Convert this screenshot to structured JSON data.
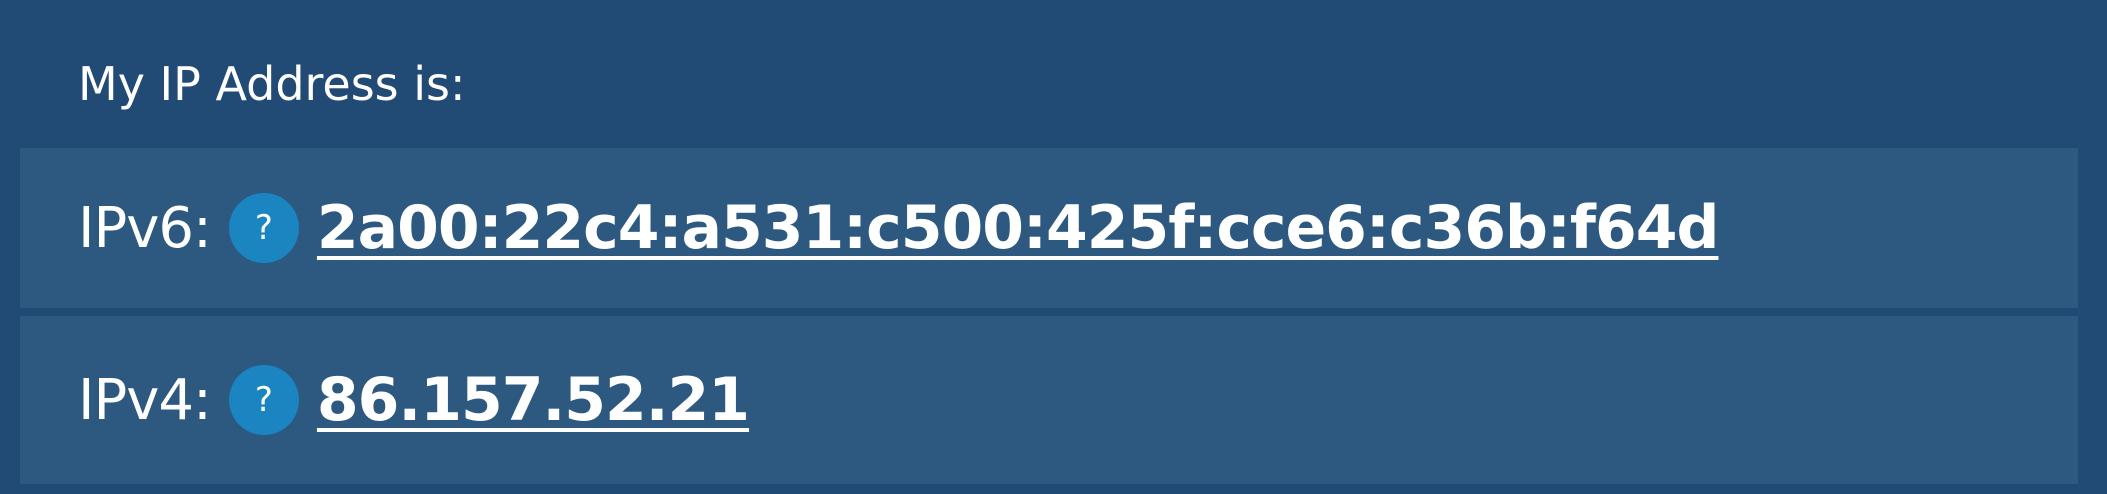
{
  "heading": "My IP Address is:",
  "rows": [
    {
      "label": "IPv6:",
      "help_icon": "?",
      "address": "2a00:22c4:a531:c500:425f:cce6:c36b:f64d"
    },
    {
      "label": "IPv4:",
      "help_icon": "?",
      "address": "86.157.52.21"
    }
  ],
  "colors": {
    "background": "#214a75",
    "row_background": "#2d5880",
    "help_icon": "#1b85c2",
    "text": "#ffffff"
  },
  "icons": {
    "help": "question-mark-icon"
  }
}
